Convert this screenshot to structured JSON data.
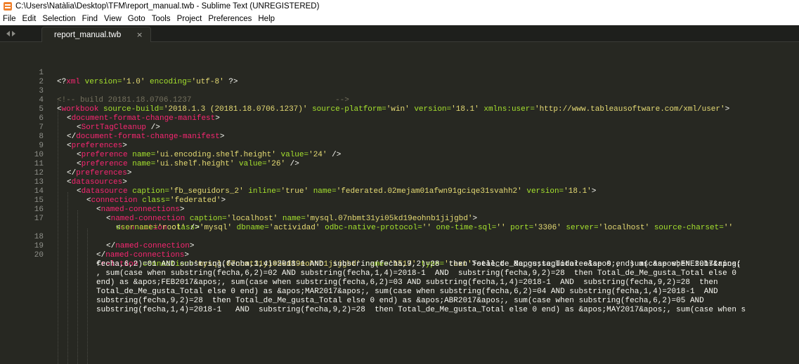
{
  "window": {
    "title": "C:\\Users\\Natàlia\\Desktop\\TFM\\report_manual.twb - Sublime Text (UNREGISTERED)"
  },
  "menu": [
    "File",
    "Edit",
    "Selection",
    "Find",
    "View",
    "Goto",
    "Tools",
    "Project",
    "Preferences",
    "Help"
  ],
  "tab": {
    "label": "report_manual.twb",
    "close": "×"
  },
  "colors": {
    "background": "#272822",
    "tag": "#f92672",
    "attr": "#a6e22e",
    "string": "#e6db74",
    "comment": "#75715e"
  },
  "lines": {
    "n1": "1",
    "n2": "2",
    "n3": "3",
    "n4": "4",
    "n5": "5",
    "n6": "6",
    "n7": "7",
    "n8": "8",
    "n9": "9",
    "n10": "10",
    "n11": "11",
    "n12": "12",
    "n13": "13",
    "n14": "14",
    "n15": "15",
    "n16": "16",
    "n17": "17",
    "n18": "18",
    "n19": "19",
    "n20": "20",
    "l1": {
      "a": "<?",
      "b": "xml",
      "c": " version=",
      "d": "'1.0'",
      "e": " encoding=",
      "f": "'utf-8'",
      "g": " ?>"
    },
    "l3": "<!-- build 20181.18.0706.1237                               -->",
    "l4": {
      "a": "<",
      "b": "workbook",
      "c": " source-build=",
      "d": "'2018.1.3 (20181.18.0706.1237)'",
      "e": " source-platform=",
      "f": "'win'",
      "g": " version=",
      "h": "'18.1'",
      "i": " xmlns:user=",
      "j": "'http://www.tableausoftware.com/xml/user'",
      "k": ">"
    },
    "l5": {
      "a": "<",
      "b": "document-format-change-manifest",
      "c": ">"
    },
    "l6": {
      "a": "<",
      "b": "SortTagCleanup",
      "c": " />"
    },
    "l7": {
      "a": "</",
      "b": "document-format-change-manifest",
      "c": ">"
    },
    "l8": {
      "a": "<",
      "b": "preferences",
      "c": ">"
    },
    "l9": {
      "a": "<",
      "b": "preference",
      "c": " name=",
      "d": "'ui.encoding.shelf.height'",
      "e": " value=",
      "f": "'24'",
      "g": " />"
    },
    "l10": {
      "a": "<",
      "b": "preference",
      "c": " name=",
      "d": "'ui.shelf.height'",
      "e": " value=",
      "f": "'26'",
      "g": " />"
    },
    "l11": {
      "a": "</",
      "b": "preferences",
      "c": ">"
    },
    "l12": {
      "a": "<",
      "b": "datasources",
      "c": ">"
    },
    "l13": {
      "a": "<",
      "b": "datasource",
      "c": " caption=",
      "d": "'fb_seguidors_2'",
      "e": " inline=",
      "f": "'true'",
      "g": " name=",
      "h": "'federated.02mejam01afwn91gciqe31svahh2'",
      "i": " version=",
      "j": "'18.1'",
      "k": ">"
    },
    "l14": {
      "a": "<",
      "b": "connection",
      "c": " class=",
      "d": "'federated'",
      "e": ">"
    },
    "l15": {
      "a": "<",
      "b": "named-connections",
      "c": ">"
    },
    "l16": {
      "a": "<",
      "b": "named-connection",
      "c": " caption=",
      "d": "'localhost'",
      "e": " name=",
      "f": "'mysql.07nbmt31yi05kd19eohnb1jijgbd'",
      "g": ">"
    },
    "l17": {
      "a": "<",
      "b": "connection",
      "c": " class=",
      "d": "'mysql'",
      "e": " dbname=",
      "f": "'actividad'",
      "g": " odbc-native-protocol=",
      "h": "''",
      "i": " one-time-sql=",
      "j": "''",
      "k": " port=",
      "l": "'3306'",
      "m": " server=",
      "n": "'localhost'",
      "o": " source-charset=",
      "p": "''"
    },
    "l17b": {
      "a": "username=",
      "b": "'root'",
      "c": " />"
    },
    "l18": {
      "a": "</",
      "b": "named-connection",
      "c": ">"
    },
    "l19": {
      "a": "</",
      "b": "named-connections",
      "c": ">"
    },
    "l20": {
      "a": "<",
      "b": "relation",
      "c": " connection=",
      "d": "'mysql.07nbmt31yi05kd19eohnb1jijgbd'",
      "e": " name=",
      "f": "'1517'",
      "g": " type=",
      "h": "'text'",
      "i": ">select  &apos;seguidores&apos;,  sum(case when substring("
    },
    "w1": "fecha,6,2)=01 AND substring(fecha,1,4)=2018-1 AND  substring(fecha,9,2)=28  then Total_de_Me_gusta_Total else 0 end) as &apos;ENE2017&apos;",
    "w2": ", sum(case when substring(fecha,6,2)=02 AND substring(fecha,1,4)=2018-1  AND  substring(fecha,9,2)=28  then Total_de_Me_gusta_Total else 0",
    "w3": "end) as &apos;FEB2017&apos;, sum(case when substring(fecha,6,2)=03 AND substring(fecha,1,4)=2018-1  AND  substring(fecha,9,2)=28  then",
    "w4": "Total_de_Me_gusta_Total else 0 end) as &apos;MAR2017&apos;, sum(case when substring(fecha,6,2)=04 AND substring(fecha,1,4)=2018-1  AND",
    "w5": "substring(fecha,9,2)=28  then Total_de_Me_gusta_Total else 0 end) as &apos;ABR2017&apos;, sum(case when substring(fecha,6,2)=05 AND",
    "w6": "substring(fecha,1,4)=2018-1   AND  substring(fecha,9,2)=28  then Total_de_Me_gusta_Total else 0 end) as &apos;MAY2017&apos;, sum(case when s"
  }
}
